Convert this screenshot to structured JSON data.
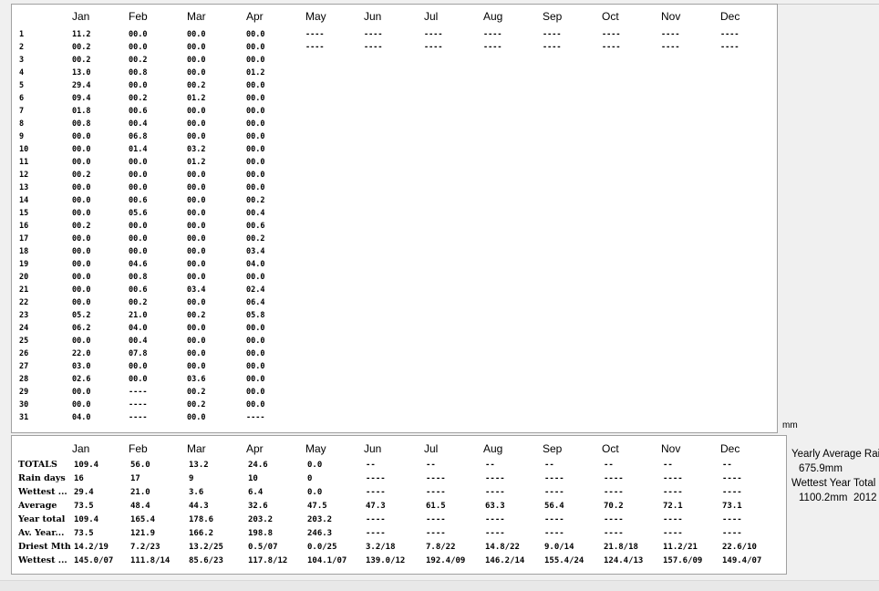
{
  "months": [
    "Jan",
    "Feb",
    "Mar",
    "Apr",
    "May",
    "Jun",
    "Jul",
    "Aug",
    "Sep",
    "Oct",
    "Nov",
    "Dec"
  ],
  "days": [
    "1",
    "2",
    "3",
    "4",
    "5",
    "6",
    "7",
    "8",
    "9",
    "10",
    "11",
    "12",
    "13",
    "14",
    "15",
    "16",
    "17",
    "18",
    "19",
    "20",
    "21",
    "22",
    "23",
    "24",
    "25",
    "26",
    "27",
    "28",
    "29",
    "30",
    "31"
  ],
  "daily_values": [
    [
      "11.2",
      "00.2",
      "00.2",
      "13.0",
      "29.4",
      "09.4",
      "01.8",
      "00.8",
      "00.0",
      "00.0",
      "00.0",
      "00.2",
      "00.0",
      "00.0",
      "00.0",
      "00.2",
      "00.0",
      "00.0",
      "00.0",
      "00.0",
      "00.0",
      "00.0",
      "05.2",
      "06.2",
      "00.0",
      "22.0",
      "03.0",
      "02.6",
      "00.0",
      "00.0",
      "04.0"
    ],
    [
      "00.0",
      "00.0",
      "00.2",
      "00.8",
      "00.0",
      "00.2",
      "00.6",
      "00.4",
      "06.8",
      "01.4",
      "00.0",
      "00.0",
      "00.0",
      "00.6",
      "05.6",
      "00.0",
      "00.0",
      "00.0",
      "04.6",
      "00.8",
      "00.6",
      "00.2",
      "21.0",
      "04.0",
      "00.4",
      "07.8",
      "00.0",
      "00.0",
      "----",
      "----",
      "----"
    ],
    [
      "00.0",
      "00.0",
      "00.0",
      "00.0",
      "00.2",
      "01.2",
      "00.0",
      "00.0",
      "00.0",
      "03.2",
      "01.2",
      "00.0",
      "00.0",
      "00.0",
      "00.0",
      "00.0",
      "00.0",
      "00.0",
      "00.0",
      "00.0",
      "03.4",
      "00.0",
      "00.2",
      "00.0",
      "00.0",
      "00.0",
      "00.0",
      "03.6",
      "00.2",
      "00.2",
      "00.0"
    ],
    [
      "00.0",
      "00.0",
      "00.0",
      "01.2",
      "00.0",
      "00.0",
      "00.0",
      "00.0",
      "00.0",
      "00.0",
      "00.0",
      "00.0",
      "00.0",
      "00.2",
      "00.4",
      "00.6",
      "00.2",
      "03.4",
      "04.0",
      "00.0",
      "02.4",
      "06.4",
      "05.8",
      "00.0",
      "00.0",
      "00.0",
      "00.0",
      "00.0",
      "00.0",
      "00.0",
      "----"
    ],
    [
      "----",
      "----"
    ],
    [
      "----",
      "----"
    ],
    [
      "----",
      "----"
    ],
    [
      "----",
      "----"
    ],
    [
      "----",
      "----"
    ],
    [
      "----",
      "----"
    ],
    [
      "----",
      "----"
    ],
    [
      "----",
      "----"
    ]
  ],
  "unit": "mm",
  "summary": {
    "rows": [
      {
        "label": "TOTALS",
        "values": [
          "109.4",
          "56.0",
          "13.2",
          "24.6",
          "0.0",
          "--",
          "--",
          "--",
          "--",
          "--",
          "--",
          "--"
        ]
      },
      {
        "label": "Rain days",
        "values": [
          "16",
          "17",
          "9",
          "10",
          "0",
          "----",
          "----",
          "----",
          "----",
          "----",
          "----",
          "----"
        ]
      },
      {
        "label": "Wettest ...",
        "values": [
          "29.4",
          "21.0",
          "3.6",
          "6.4",
          "0.0",
          "----",
          "----",
          "----",
          "----",
          "----",
          "----",
          "----"
        ]
      },
      {
        "label": "Average",
        "values": [
          "73.5",
          "48.4",
          "44.3",
          "32.6",
          "47.5",
          "47.3",
          "61.5",
          "63.3",
          "56.4",
          "70.2",
          "72.1",
          "73.1"
        ]
      },
      {
        "label": "Year total",
        "values": [
          "109.4",
          "165.4",
          "178.6",
          "203.2",
          "203.2",
          "----",
          "----",
          "----",
          "----",
          "----",
          "----",
          "----"
        ]
      },
      {
        "label": "Av. Year...",
        "values": [
          "73.5",
          "121.9",
          "166.2",
          "198.8",
          "246.3",
          "----",
          "----",
          "----",
          "----",
          "----",
          "----",
          "----"
        ]
      },
      {
        "label": "Driest Mth",
        "values": [
          "14.2/19",
          "7.2/23",
          "13.2/25",
          "0.5/07",
          "0.0/25",
          "3.2/18",
          "7.8/22",
          "14.8/22",
          "9.0/14",
          "21.8/18",
          "11.2/21",
          "22.6/10"
        ]
      },
      {
        "label": "Wettest ...",
        "values": [
          "145.0/07",
          "111.8/14",
          "85.6/23",
          "117.8/12",
          "104.1/07",
          "139.0/12",
          "192.4/09",
          "146.2/14",
          "155.4/24",
          "124.4/13",
          "157.6/09",
          "149.4/07"
        ]
      }
    ]
  },
  "side": {
    "yearly_avg_label": "Yearly Average Rain",
    "yearly_avg_value": "675.9mm",
    "wettest_label": "Wettest Year Total",
    "wettest_value": "1100.2mm",
    "wettest_year": "2012"
  }
}
